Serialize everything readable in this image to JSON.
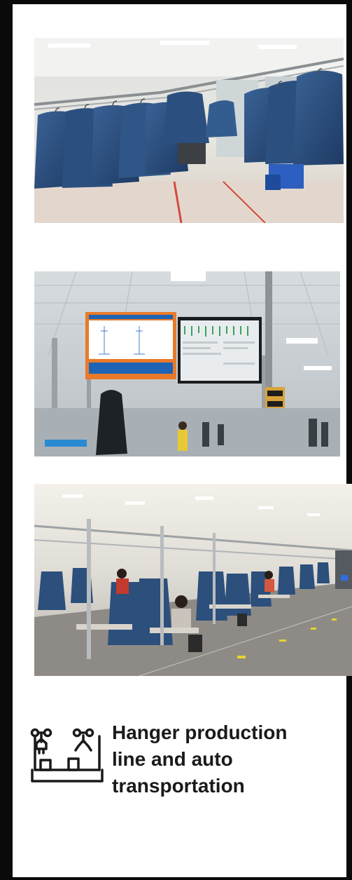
{
  "photos": [
    {
      "name": "hanging-jackets-photo",
      "description": "Blue down jackets on overhead hanger rail"
    },
    {
      "name": "monitoring-screens-photo",
      "description": "Production line with monitoring displays"
    },
    {
      "name": "sewing-floor-photo",
      "description": "Workers at sewing stations along hanger line"
    }
  ],
  "feature": {
    "icon": "robotic-arms-hanger-icon",
    "title": "Hanger production\nline and auto\ntransportation"
  },
  "colors": {
    "frame": "#0a0a0a",
    "text": "#1a1a1a",
    "jacket_blue": "#2b4f7e"
  }
}
